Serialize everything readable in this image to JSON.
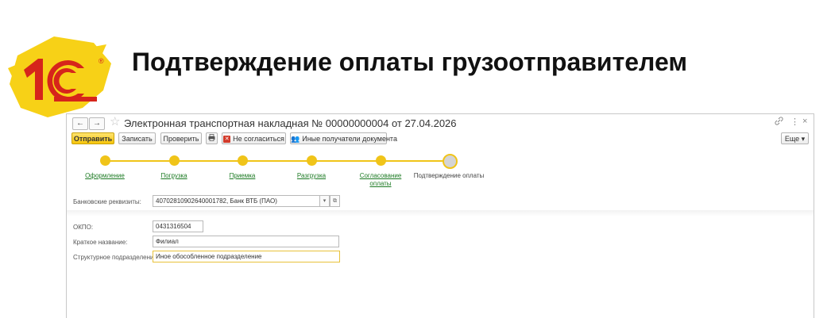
{
  "slide": {
    "title": "Подтверждение оплаты грузоотправителем"
  },
  "logo": {
    "text": "1С",
    "colors": {
      "background": "#f7d117",
      "mark": "#d6251b"
    }
  },
  "window": {
    "title": "Электронная транспортная накладная № 00000000004 от 27.04.2026",
    "nav": {
      "back": "←",
      "forward": "→"
    },
    "icons": {
      "link": "🔗",
      "more": "⋮",
      "close": "×"
    }
  },
  "toolbar": {
    "send": "Отправить",
    "save": "Записать",
    "check": "Проверить",
    "disagree": "Не согласиться",
    "other_recipients": "Иные получатели документа",
    "more": "Еще ▾"
  },
  "steps": [
    {
      "label": "Оформление",
      "state": "done"
    },
    {
      "label": "Погрузка",
      "state": "done"
    },
    {
      "label": "Приемка",
      "state": "done"
    },
    {
      "label": "Разгрузка",
      "state": "done"
    },
    {
      "label_line1": "Согласование",
      "label_line2": "оплаты",
      "state": "done"
    },
    {
      "label": "Подтверждение оплаты",
      "state": "current"
    }
  ],
  "form": {
    "bank_label": "Банковские реквизиты:",
    "bank_value": "40702810902640001782, Банк ВТБ (ПАО)",
    "okpo_label": "ОКПО:",
    "okpo_value": "0431316504",
    "short_name_label": "Краткое название:",
    "short_name_value": "Филиал",
    "division_label": "Структурное подразделение:",
    "division_value": "Иное обособленное подразделение"
  },
  "accent_color": "#f0c419"
}
